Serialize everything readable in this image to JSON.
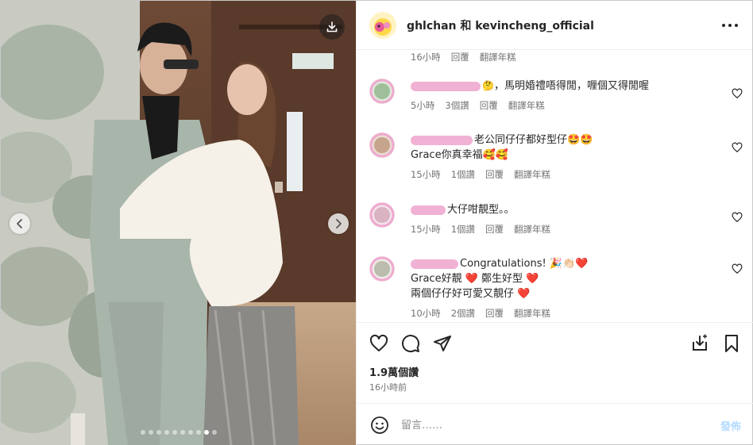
{
  "post": {
    "header_names": "ghlchan 和 kevincheng_official",
    "likes": "1.9萬個讚",
    "posted_time": "16小時前",
    "carousel_total": 10,
    "carousel_active": 9
  },
  "top_meta": {
    "time": "16小時",
    "reply": "回覆",
    "translate": "翻譯年糕"
  },
  "comments": [
    {
      "lines": [
        "，馬明婚禮唔得閒，喱個又得閒喔"
      ],
      "emoji": "🤔",
      "time": "5小時",
      "likes": "3個讚",
      "reply": "回覆",
      "translate": "翻譯年糕"
    },
    {
      "lines": [
        "老公同仔仔都好型仔🤩🤩",
        "Grace你真幸福🥰🥰"
      ],
      "time": "15小時",
      "likes": "1個讚",
      "reply": "回覆",
      "translate": "翻譯年糕"
    },
    {
      "lines": [
        "大仔咁靚型。。"
      ],
      "time": "15小時",
      "likes": "1個讚",
      "reply": "回覆",
      "translate": "翻譯年糕"
    },
    {
      "lines": [
        "Congratulations! 🎉👏🏻❤️",
        "Grace好靚 ❤️ 鄭生好型 ❤️",
        "兩個仔仔好可愛又靚仔 ❤️"
      ],
      "time": "10小時",
      "likes": "2個讚",
      "reply": "回覆",
      "translate": "翻譯年糕"
    }
  ],
  "composer": {
    "placeholder": "留言……",
    "post_label": "發佈"
  },
  "colors": {
    "accent": "#0095f6",
    "redaction_pink": "#f0a9cf",
    "meta_grey": "#737373"
  }
}
